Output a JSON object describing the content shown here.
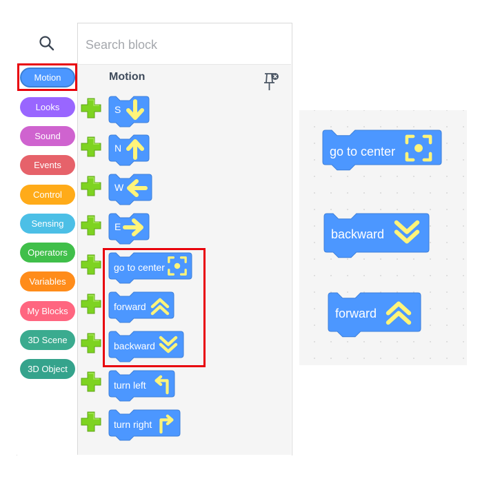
{
  "search": {
    "placeholder": "Search block"
  },
  "categories": [
    {
      "label": "Motion",
      "color": "#4c97ff"
    },
    {
      "label": "Looks",
      "color": "#9966ff"
    },
    {
      "label": "Sound",
      "color": "#cf63cf"
    },
    {
      "label": "Events",
      "color": "#e6626a"
    },
    {
      "label": "Control",
      "color": "#ffab19"
    },
    {
      "label": "Sensing",
      "color": "#4cbfe6"
    },
    {
      "label": "Operators",
      "color": "#40bf4a"
    },
    {
      "label": "Variables",
      "color": "#ff8c1a"
    },
    {
      "label": "My Blocks",
      "color": "#ff6680"
    },
    {
      "label": "3D Scene",
      "color": "#3bab8f"
    },
    {
      "label": "3D Object",
      "color": "#35a38c"
    }
  ],
  "palette": {
    "title": "Motion",
    "blocks": [
      {
        "label": "S",
        "icon": "arrow-down-icon"
      },
      {
        "label": "N",
        "icon": "arrow-up-icon"
      },
      {
        "label": "W",
        "icon": "arrow-left-icon"
      },
      {
        "label": "E",
        "icon": "arrow-right-icon"
      },
      {
        "label": "go to center",
        "icon": "center-target-icon"
      },
      {
        "label": "forward",
        "icon": "chevrons-up-icon"
      },
      {
        "label": "backward",
        "icon": "chevrons-down-icon"
      },
      {
        "label": "turn left",
        "icon": "turn-left-icon"
      },
      {
        "label": "turn right",
        "icon": "turn-right-icon"
      }
    ]
  },
  "workspace": {
    "blocks": [
      {
        "label": "go to center",
        "icon": "center-target-icon"
      },
      {
        "label": "backward",
        "icon": "chevrons-down-icon"
      },
      {
        "label": "forward",
        "icon": "chevrons-up-icon"
      }
    ]
  },
  "colors": {
    "block_fill": "#4c97ff",
    "block_stroke": "#3d7fd9",
    "icon_yellow": "#fff47a",
    "plus_green": "#7ed321",
    "highlight": "#e8000b"
  }
}
